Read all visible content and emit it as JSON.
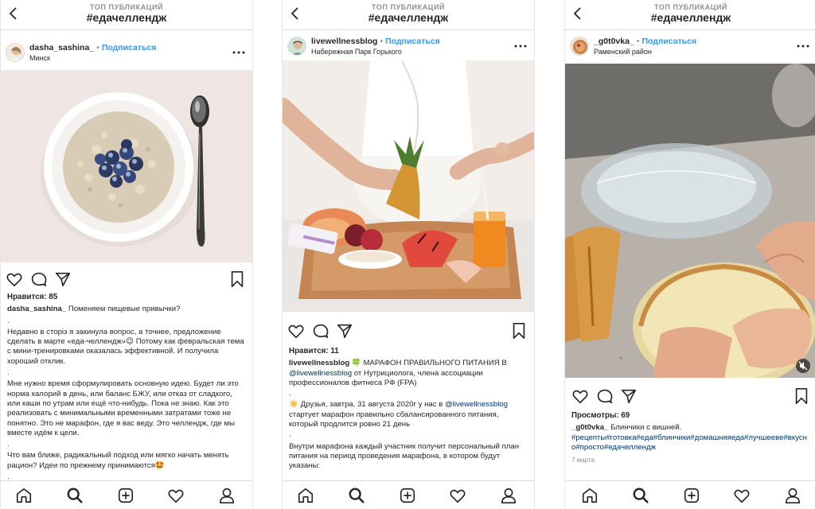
{
  "posts": [
    {
      "top_label": "ТОП ПУБЛИКАЦИЙ",
      "hashtag": "#едачеллендж",
      "username": "dasha_sashina_",
      "dot": "•",
      "follow": "Подписаться",
      "location": "Минск",
      "likes": "Нравится: 85",
      "caption_user": "dasha_sashina_",
      "caption_first": "Поменяем пищевые привычки?",
      "lines": [
        ".",
        "Недавно в сторіз я закинула вопрос, а точнее, предложение сделать в марте «еда-челлендж»😉 Потому как февральская тема с мини-тренировками оказалась эффективной. И получила хороший отклик.",
        ".",
        "Мне нужно время сформулировать основную идею. Будет ли это норма калорий в день, или баланс БЖУ, или отказ от сладкого, или каши по утрам или ещё что-нибудь. Пока не знаю. Как это реализовать с минимальными временными затратами тоже не понятно. Это не марафон, где я вас веду. Это челлендж, где мы вместе идём к цели.",
        ".",
        "Что вам ближе, радикальный подход или мягко начать менять рацион? Идеи по прежнему принимаются🤩",
        "."
      ]
    },
    {
      "top_label": "ТОП ПУБЛИКАЦИЙ",
      "hashtag": "#едачеллендж",
      "username": "livewellnessblog",
      "dot": "•",
      "follow": "Подписаться",
      "location": "Набережная Парк Горького",
      "likes": "Нравится: 11",
      "caption_user": "livewellnessblog",
      "caption_first": "🍀 МАРАФОН ПРАВИЛЬНОГО ПИТАНИЯ В",
      "mention1": "@livewellnessblog",
      "caption_rest1": " от Нутрициолога, члена ассоциации профессионалов фитнеса РФ (FPA)",
      "sep": ".",
      "p2_start": "☀️ Друзья, завтра, 31 августа 2020г у нас в",
      "mention2": "@livewellnessblog",
      "p2_rest": "  стартует марафон правильно сбалансированного питания, который продлится ровно 21 день",
      "p3": "Внутри марафона каждый участник получит персональный план питания на период проведения марафона, в котором будут указаны:"
    },
    {
      "top_label": "ТОП ПУБЛИКАЦИЙ",
      "hashtag": "#едачеллендж",
      "username": "_g0t0vka_",
      "dot": "•",
      "follow": "Подписаться",
      "location": "Раменский район",
      "views": "Просмотры: 69",
      "caption_user": "_g0t0vka_",
      "caption_first": "Блинчики с вишней.",
      "tags": "#рецепты#готовка#еда#блинчики#домашняяеда#лучшееве#вкусно#просто#едачеллендж",
      "date": "7 марта"
    }
  ],
  "colors": {
    "link": "#3897f0",
    "tag": "#003569",
    "border": "#dbdbdb",
    "muted": "#8e8e8e"
  },
  "icons": [
    "back-chevron-icon",
    "more-icon",
    "heart-icon",
    "comment-icon",
    "share-icon",
    "bookmark-icon",
    "home-icon",
    "search-icon",
    "add-icon",
    "activity-heart-icon",
    "profile-icon",
    "mute-icon"
  ]
}
